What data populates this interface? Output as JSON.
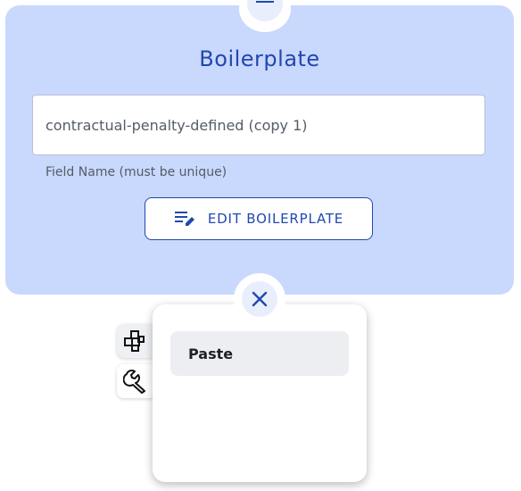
{
  "card": {
    "title": "Boilerplate",
    "field": {
      "value": "contractual-penalty-defined (copy 1)",
      "helper": "Field Name (must be unique)"
    },
    "edit_button_label": "EDIT BOILERPLATE",
    "menu_icon": "hamburger-menu-icon",
    "edit_icon": "edit-list-icon"
  },
  "popup": {
    "close_icon": "close-icon",
    "tools": [
      {
        "icon": "blocks-icon"
      },
      {
        "icon": "wrench-icon"
      }
    ],
    "menu_items": [
      {
        "label": "Paste"
      }
    ]
  },
  "colors": {
    "accent": "#2148ae",
    "card_bg": "#c9d8fd",
    "circle_bg": "#e9eefc"
  }
}
